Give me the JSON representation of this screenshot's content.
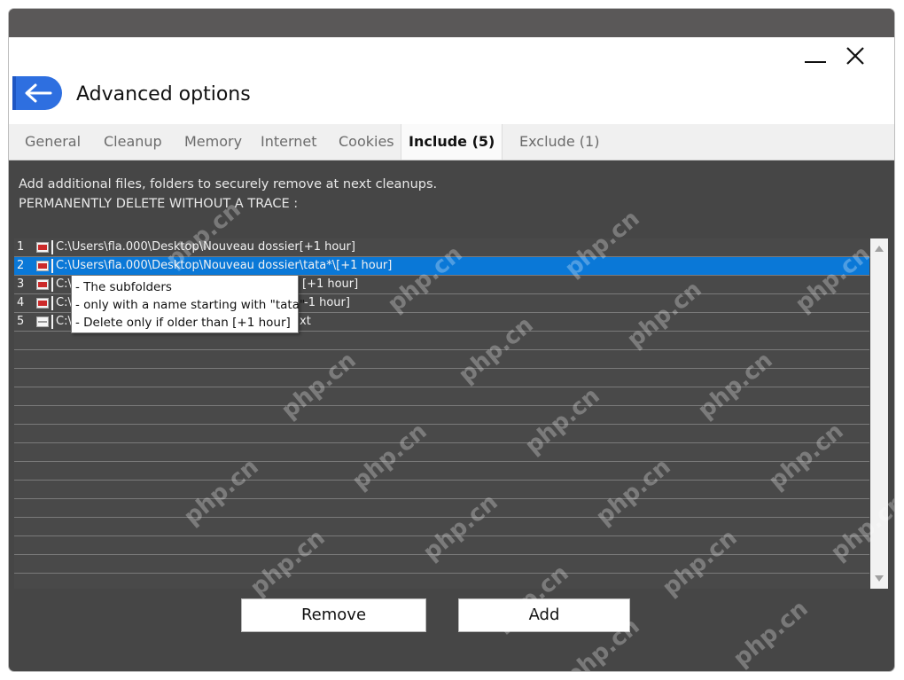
{
  "window": {
    "title": "Advanced options",
    "minimize_label": "minimize",
    "close_label": "close"
  },
  "tabs": [
    {
      "label": "General",
      "active": false
    },
    {
      "label": "Cleanup",
      "active": false
    },
    {
      "label": "Memory",
      "active": false
    },
    {
      "label": "Internet",
      "active": false
    },
    {
      "label": "Cookies",
      "active": false
    },
    {
      "label": "Include (5)",
      "active": true
    },
    {
      "label": "Exclude (1)",
      "active": false
    }
  ],
  "description": {
    "line1": "Add additional files, folders to securely remove at next cleanups.",
    "line2": "PERMANENTLY DELETE WITHOUT A TRACE :"
  },
  "items": [
    {
      "num": "1",
      "path": "C:\\Users\\fla.000\\Desktop\\Nouveau dossier[+1 hour]",
      "icon": "folder-icon"
    },
    {
      "num": "2",
      "path": "C:\\Users\\fla.000\\Desktop\\Nouveau dossier\\tata*\\[+1 hour]",
      "icon": "folder-icon",
      "selected": true
    },
    {
      "num": "3",
      "path": "C:\\",
      "suffix": "[+1 hour]",
      "icon": "folder-icon"
    },
    {
      "num": "4",
      "path": "C:\\",
      "suffix": "-1 hour]",
      "icon": "folder-icon"
    },
    {
      "num": "5",
      "path": "C:\\",
      "suffix": "xt",
      "icon": "file-icon"
    }
  ],
  "tooltip": {
    "line1": "- The subfolders",
    "line2": "- only with a name starting with \"tata\"",
    "line3": "- Delete only if older than [+1 hour]"
  },
  "buttons": {
    "remove": "Remove",
    "add": "Add"
  },
  "watermark": "php.cn",
  "colors": {
    "accent": "#2e6fe0",
    "selection": "#0a78d7",
    "panel": "#464646"
  }
}
